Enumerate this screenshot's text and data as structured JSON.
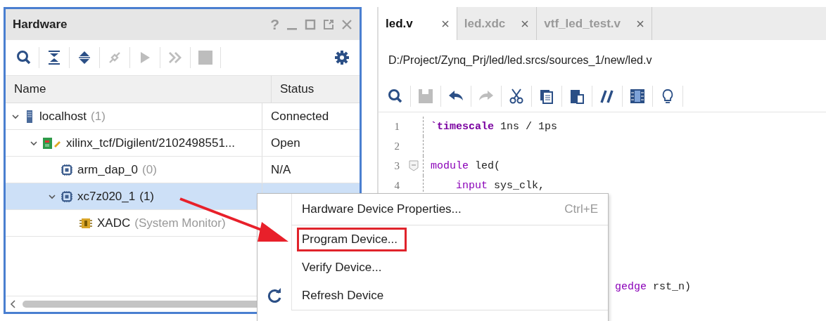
{
  "hardware_panel": {
    "title": "Hardware",
    "window_buttons": [
      {
        "kind": "help",
        "label": "?"
      },
      {
        "kind": "minimize"
      },
      {
        "kind": "maximize"
      },
      {
        "kind": "float"
      },
      {
        "kind": "close"
      }
    ],
    "toolbar": [
      {
        "kind": "search",
        "disabled": false
      },
      {
        "kind": "collapse",
        "disabled": false
      },
      {
        "kind": "expand",
        "disabled": false
      },
      {
        "kind": "connect",
        "disabled": true
      },
      {
        "kind": "run",
        "disabled": true
      },
      {
        "kind": "forward",
        "disabled": true
      },
      {
        "kind": "stop",
        "disabled": true
      }
    ],
    "columns": [
      "Name",
      "Status"
    ],
    "tree": [
      {
        "kind": "host",
        "name": "localhost",
        "count": "(1)",
        "status": "Connected",
        "expanded": true,
        "selected": false,
        "children": [
          {
            "kind": "board",
            "name": "xilinx_tcf/Digilent/2102498551...",
            "status": "Open",
            "expanded": true,
            "selected": false,
            "children": [
              {
                "kind": "chip",
                "name": "arm_dap_0",
                "count": "(0)",
                "status": "N/A",
                "selected": false
              },
              {
                "kind": "chip",
                "name": "xc7z020_1",
                "count": "(1)",
                "expanded": true,
                "selected": true,
                "children": [
                  {
                    "kind": "monitor",
                    "name": "XADC",
                    "count": "(System Monitor)",
                    "selected": false
                  }
                ]
              }
            ]
          }
        ]
      }
    ]
  },
  "editor": {
    "tabs": [
      {
        "label": "led.v",
        "selected": true
      },
      {
        "label": "led.xdc",
        "selected": false
      },
      {
        "label": "vtf_led_test.v",
        "selected": false
      }
    ],
    "path": "D:/Project/Zynq_Prj/led/led.srcs/sources_1/new/led.v",
    "toolbar": [
      {
        "kind": "search",
        "disabled": false
      },
      {
        "kind": "save",
        "disabled": true
      },
      {
        "kind": "undo",
        "disabled": false
      },
      {
        "kind": "redo",
        "disabled": true
      },
      {
        "kind": "cut",
        "disabled": false
      },
      {
        "kind": "copy",
        "disabled": false
      },
      {
        "kind": "paste",
        "disabled": false
      },
      {
        "kind": "comment",
        "disabled": false
      },
      {
        "kind": "columns",
        "disabled": false
      },
      {
        "kind": "hint",
        "disabled": false
      }
    ],
    "lines": [
      {
        "number": "1",
        "kind": "plain",
        "tokens": [
          {
            "kind": "directive",
            "text": "`timescale"
          },
          {
            "kind": "plain",
            "text": " 1ns / 1ps"
          }
        ]
      },
      {
        "number": "2",
        "kind": "plain"
      },
      {
        "number": "3",
        "kind": "fold",
        "tokens": [
          {
            "kind": "keyword",
            "text": "module"
          },
          {
            "kind": "plain",
            "text": " led("
          }
        ]
      },
      {
        "number": "4",
        "kind": "body",
        "tokens": [
          {
            "kind": "keyword",
            "text": "input"
          },
          {
            "kind": "plain",
            "text": " sys_clk,"
          }
        ]
      }
    ],
    "partial_line": [
      {
        "kind": "keyword",
        "text": "gedge"
      },
      {
        "kind": "plain",
        "text": " rst_n)"
      }
    ]
  },
  "context_menu": {
    "items": [
      {
        "kind": "plain",
        "label": "Hardware Device Properties...",
        "shortcut": "Ctrl+E",
        "highlighted": false,
        "separator_after": true
      },
      {
        "kind": "plain",
        "label": "Program Device...",
        "highlighted": true,
        "separator_after": false
      },
      {
        "kind": "plain",
        "label": "Verify Device...",
        "highlighted": false,
        "separator_after": false
      },
      {
        "kind": "refresh",
        "label": "Refresh Device",
        "highlighted": false,
        "separator_after": true
      }
    ]
  }
}
